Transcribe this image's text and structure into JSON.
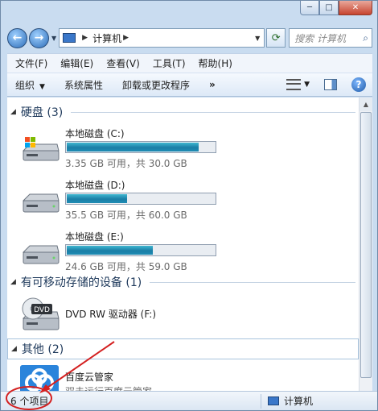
{
  "window": {
    "caption": {
      "minimize": "─",
      "maximize": "□",
      "close": "✕"
    }
  },
  "nav": {
    "back": "←",
    "forward": "→",
    "address_path": "计算机",
    "search_placeholder": "搜索 计算机"
  },
  "menu": [
    "文件(F)",
    "编辑(E)",
    "查看(V)",
    "工具(T)",
    "帮助(H)"
  ],
  "toolbar": {
    "organize": "组织",
    "system_properties": "系统属性",
    "uninstall": "卸载或更改程序",
    "more": "»"
  },
  "groups": {
    "hard_disks": "硬盘 (3)",
    "removable": "有可移动存储的设备 (1)",
    "other": "其他 (2)"
  },
  "drives": [
    {
      "name": "本地磁盘 (C:)",
      "info": "3.35 GB 可用，共 30.0 GB",
      "used_fraction": 0.89,
      "icon": "windows-drive-icon"
    },
    {
      "name": "本地磁盘 (D:)",
      "info": "35.5 GB 可用，共 60.0 GB",
      "used_fraction": 0.41,
      "icon": "hard-drive-icon"
    },
    {
      "name": "本地磁盘 (E:)",
      "info": "24.6 GB 可用，共 59.0 GB",
      "used_fraction": 0.58,
      "icon": "hard-drive-icon"
    }
  ],
  "dvd": {
    "name": "DVD RW 驱动器 (F:)",
    "icon_label": "DVD"
  },
  "apps": [
    {
      "name": "百度云管家",
      "desc": "双击运行百度云管家"
    }
  ],
  "status": {
    "item_count": "6 个项目",
    "location": "计算机"
  },
  "colors": {
    "accent": "#1a7ea6",
    "annotation": "#d42020"
  }
}
